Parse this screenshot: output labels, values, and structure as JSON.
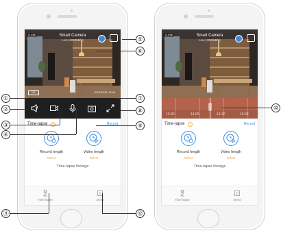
{
  "camera": {
    "name": "Smart Camera",
    "status": "Live  (3024kB/s)",
    "corner_tag": "Q.1080",
    "quality_label": "HD",
    "live_time": "2019/12/11 10:42"
  },
  "timeline": {
    "ticks": [
      "13:30",
      "14:00",
      "14:30",
      "15:00"
    ]
  },
  "timelapse": {
    "title": "Time-lapse",
    "help_glyph": "?",
    "record_link": "Record",
    "cards": [
      {
        "label": "Record length",
        "action": "Select"
      },
      {
        "label": "Video length",
        "action": "Select"
      }
    ],
    "footage_label": "Time-lapse footage"
  },
  "tabs": [
    {
      "label": "Time lapse"
    },
    {
      "label": "Alerts"
    }
  ],
  "callouts": [
    "①",
    "②",
    "③",
    "④",
    "⑤",
    "⑥",
    "⑦",
    "⑧",
    "⑨",
    "⑩",
    "⑪",
    "⑫"
  ],
  "colors": {
    "accent_blue": "#3a8ee6",
    "accent_orange": "#f09a3c",
    "timeline_red": "#a35b45",
    "control_bar": "#1f1f1f"
  },
  "icons": {
    "sound": "speaker-icon",
    "record": "video-record-icon",
    "talk": "microphone-icon",
    "screenshot": "camera-snapshot-icon",
    "fullscreen": "expand-icon",
    "settings": "settings-icon",
    "sd": "sd-card-icon",
    "record_length": "clock-record-icon",
    "video_length": "clock-video-icon",
    "time_lapse_tab": "hourglass-icon",
    "alerts_tab": "alert-box-icon"
  }
}
